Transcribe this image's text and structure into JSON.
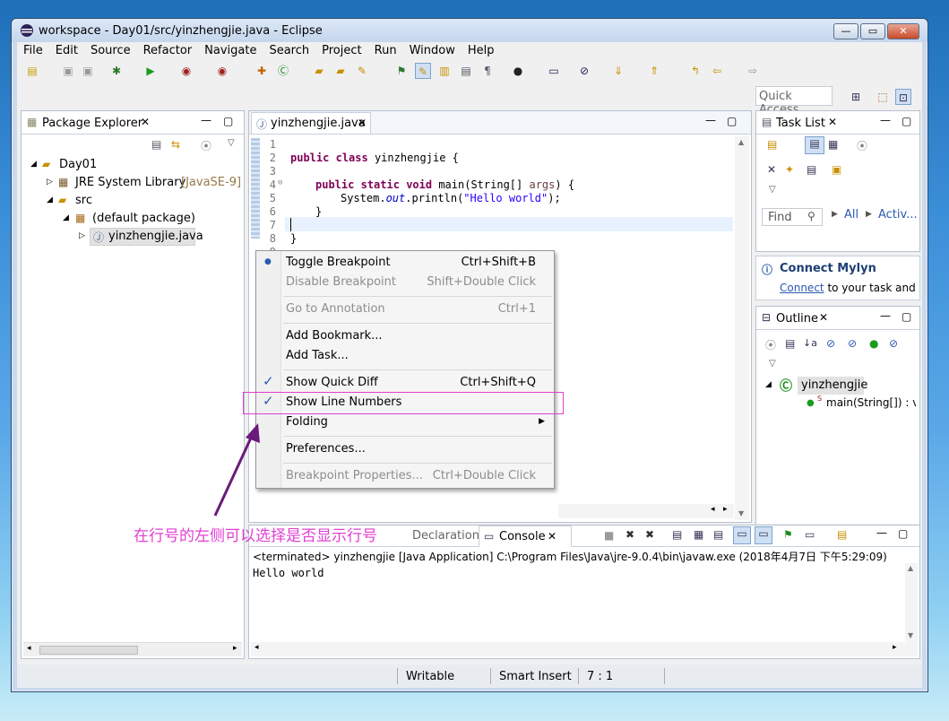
{
  "window": {
    "title": "workspace - Day01/src/yinzhengjie.java - Eclipse",
    "min": "—",
    "max": "▭",
    "close": "✕"
  },
  "menubar": [
    "File",
    "Edit",
    "Source",
    "Refactor",
    "Navigate",
    "Search",
    "Project",
    "Run",
    "Window",
    "Help"
  ],
  "quick_access": "Quick Access",
  "package_explorer": {
    "tab": "Package Explorer",
    "tree": {
      "project": "Day01",
      "jre": "JRE System Library",
      "jre_version": "[JavaSE-9]",
      "src": "src",
      "package": "(default package)",
      "file": "yinzhengjie.java"
    }
  },
  "editor": {
    "tab": "yinzhengjie.java",
    "line_numbers": [
      "1",
      "2",
      "3",
      "4",
      "5",
      "6",
      "7",
      "8",
      "9"
    ],
    "code": {
      "l2_kw1": "public",
      "l2_kw2": "class",
      "l2_rest": "yinzhengjie {",
      "l4_kw1": "public",
      "l4_kw2": "static",
      "l4_kw3": "void",
      "l4_rest1": "main(String[] ",
      "l4_param": "args",
      "l4_rest2": ") {",
      "l5_a": "System.",
      "l5_field": "out",
      "l5_b": ".println(",
      "l5_str": "\"Hello world\"",
      "l5_c": ");",
      "l6": "}",
      "l8": "}"
    }
  },
  "context_menu": {
    "items": [
      {
        "label": "Toggle Breakpoint",
        "accel": "Ctrl+Shift+B"
      },
      {
        "label": "Disable Breakpoint",
        "accel": "Shift+Double Click"
      },
      {
        "label": "Go to Annotation",
        "accel": "Ctrl+1"
      },
      {
        "label": "Add Bookmark..."
      },
      {
        "label": "Add Task..."
      },
      {
        "label": "Show Quick Diff",
        "accel": "Ctrl+Shift+Q"
      },
      {
        "label": "Show Line Numbers"
      },
      {
        "label": "Folding"
      },
      {
        "label": "Preferences..."
      },
      {
        "label": "Breakpoint Properties...",
        "accel": "Ctrl+Double Click"
      }
    ]
  },
  "task_list": {
    "tab": "Task List",
    "find_placeholder": "Find",
    "all": "All",
    "activ": "Activ..."
  },
  "mylyn": {
    "title": "Connect Mylyn",
    "link": "Connect",
    "text": " to your task and A"
  },
  "outline": {
    "tab": "Outline",
    "class": "yinzhengjie",
    "method": "main(String[]) : vo",
    "static": "S"
  },
  "bottom_tabs": {
    "declaration": "Declaration",
    "console": "Console"
  },
  "console": {
    "header": "<terminated> yinzhengjie [Java Application] C:\\Program Files\\Java\\jre-9.0.4\\bin\\javaw.exe (2018年4月7日 下午5:29:09)",
    "output": "Hello world"
  },
  "status": {
    "writable": "Writable",
    "insert": "Smart Insert",
    "pos": "7 : 1"
  },
  "annotation": "在行号的左侧可以选择是否显示行号",
  "colors": {
    "accent": "#e23fd3",
    "keyword": "#7f0055",
    "string": "#2a00ff"
  }
}
